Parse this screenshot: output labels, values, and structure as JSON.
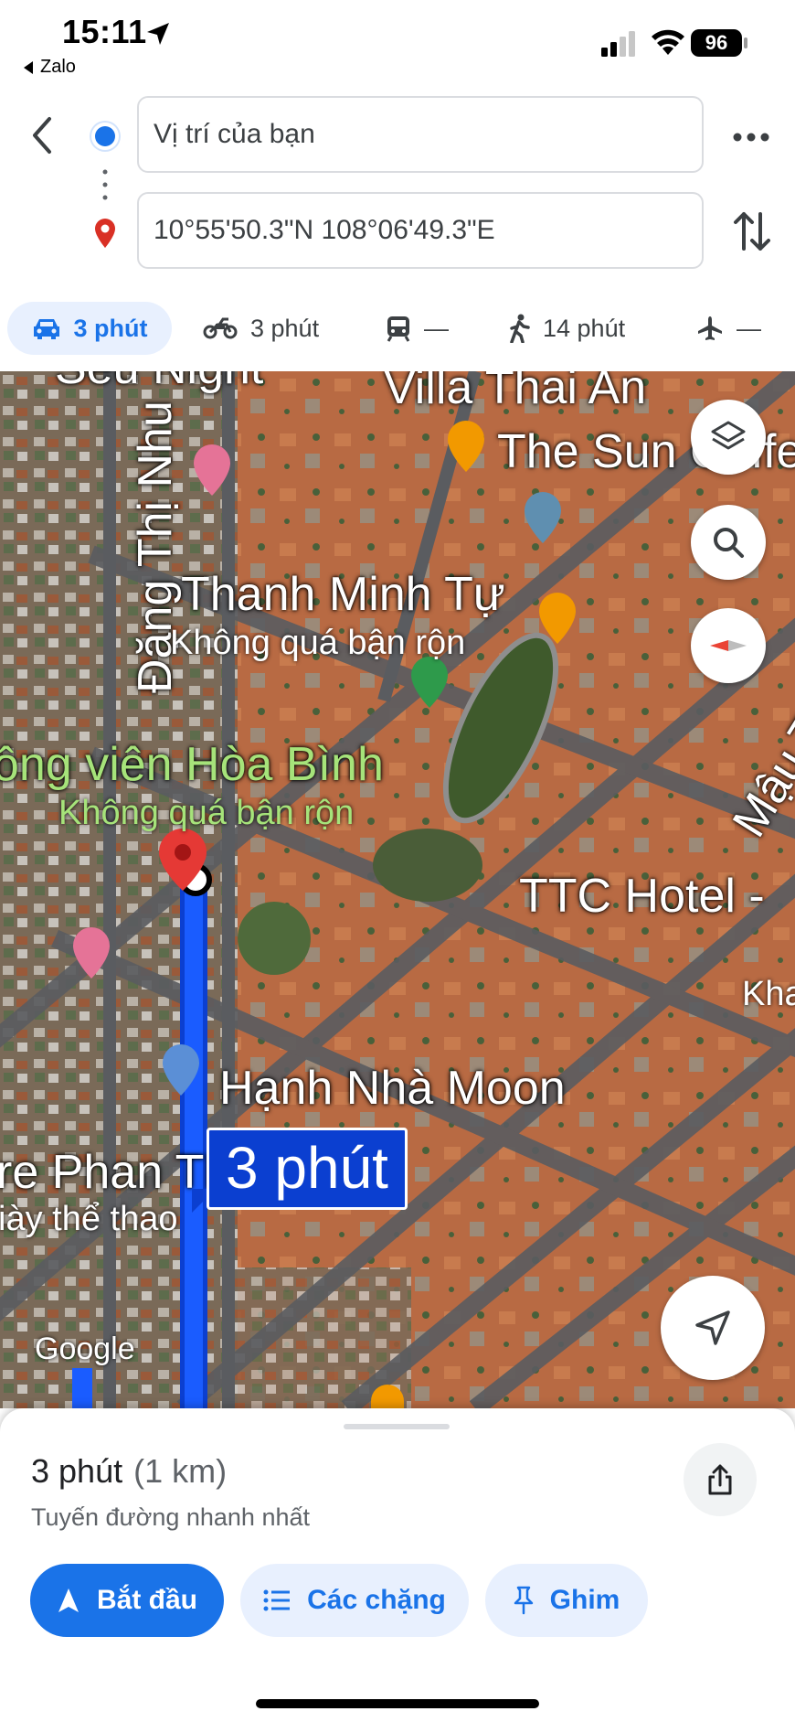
{
  "status_bar": {
    "time": "15:11",
    "back_app": "Zalo",
    "battery": "96"
  },
  "directions": {
    "origin_value": "Vị trí của bạn",
    "destination_value": "10°55'50.3\"N 108°06'49.3\"E"
  },
  "modes": [
    {
      "name": "car",
      "label": "3 phút",
      "selected": true
    },
    {
      "name": "motorbike",
      "label": "3 phút"
    },
    {
      "name": "transit",
      "label": "—"
    },
    {
      "name": "walk",
      "label": "14 phút"
    },
    {
      "name": "flight",
      "label": "—"
    }
  ],
  "map": {
    "labels": {
      "street_dang_thi_nhu": "Đặng Thị Nhu",
      "villa": "Villa Thai An",
      "sun_coffee": "The Sun Coffe",
      "thanh_minh_tu": "Thanh Minh Tự",
      "thanh_minh_tu_sub": "Không quá bận rộn",
      "park": "ông viên Hòa Bình",
      "park_sub": "Không quá bận rộn",
      "street_mau_than": "Mậu Thâ",
      "ttc_hotel": "TTC Hotel -",
      "kha": "Kha",
      "moon": "Hạnh Nhà Moon",
      "phan_thiet": "re Phan Thiết",
      "giay": "iày thể thao",
      "top_cut": "Seu Night"
    },
    "eta_bubble": "3 phút",
    "google": "Google"
  },
  "sheet": {
    "duration": "3 phút",
    "distance": "(1 km)",
    "route_desc": "Tuyến đường nhanh nhất",
    "start_label": "Bắt đầu",
    "steps_label": "Các chặng",
    "pin_label": "Ghim"
  }
}
